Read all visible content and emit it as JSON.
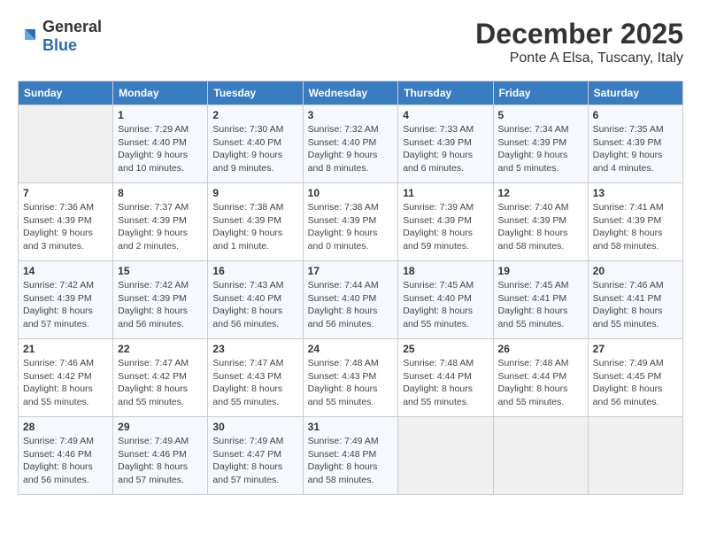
{
  "logo": {
    "general": "General",
    "blue": "Blue"
  },
  "header": {
    "month": "December 2025",
    "location": "Ponte A Elsa, Tuscany, Italy"
  },
  "weekdays": [
    "Sunday",
    "Monday",
    "Tuesday",
    "Wednesday",
    "Thursday",
    "Friday",
    "Saturday"
  ],
  "weeks": [
    [
      {
        "day": "",
        "info": ""
      },
      {
        "day": "1",
        "info": "Sunrise: 7:29 AM\nSunset: 4:40 PM\nDaylight: 9 hours\nand 10 minutes."
      },
      {
        "day": "2",
        "info": "Sunrise: 7:30 AM\nSunset: 4:40 PM\nDaylight: 9 hours\nand 9 minutes."
      },
      {
        "day": "3",
        "info": "Sunrise: 7:32 AM\nSunset: 4:40 PM\nDaylight: 9 hours\nand 8 minutes."
      },
      {
        "day": "4",
        "info": "Sunrise: 7:33 AM\nSunset: 4:39 PM\nDaylight: 9 hours\nand 6 minutes."
      },
      {
        "day": "5",
        "info": "Sunrise: 7:34 AM\nSunset: 4:39 PM\nDaylight: 9 hours\nand 5 minutes."
      },
      {
        "day": "6",
        "info": "Sunrise: 7:35 AM\nSunset: 4:39 PM\nDaylight: 9 hours\nand 4 minutes."
      }
    ],
    [
      {
        "day": "7",
        "info": "Sunrise: 7:36 AM\nSunset: 4:39 PM\nDaylight: 9 hours\nand 3 minutes."
      },
      {
        "day": "8",
        "info": "Sunrise: 7:37 AM\nSunset: 4:39 PM\nDaylight: 9 hours\nand 2 minutes."
      },
      {
        "day": "9",
        "info": "Sunrise: 7:38 AM\nSunset: 4:39 PM\nDaylight: 9 hours\nand 1 minute."
      },
      {
        "day": "10",
        "info": "Sunrise: 7:38 AM\nSunset: 4:39 PM\nDaylight: 9 hours\nand 0 minutes."
      },
      {
        "day": "11",
        "info": "Sunrise: 7:39 AM\nSunset: 4:39 PM\nDaylight: 8 hours\nand 59 minutes."
      },
      {
        "day": "12",
        "info": "Sunrise: 7:40 AM\nSunset: 4:39 PM\nDaylight: 8 hours\nand 58 minutes."
      },
      {
        "day": "13",
        "info": "Sunrise: 7:41 AM\nSunset: 4:39 PM\nDaylight: 8 hours\nand 58 minutes."
      }
    ],
    [
      {
        "day": "14",
        "info": "Sunrise: 7:42 AM\nSunset: 4:39 PM\nDaylight: 8 hours\nand 57 minutes."
      },
      {
        "day": "15",
        "info": "Sunrise: 7:42 AM\nSunset: 4:39 PM\nDaylight: 8 hours\nand 56 minutes."
      },
      {
        "day": "16",
        "info": "Sunrise: 7:43 AM\nSunset: 4:40 PM\nDaylight: 8 hours\nand 56 minutes."
      },
      {
        "day": "17",
        "info": "Sunrise: 7:44 AM\nSunset: 4:40 PM\nDaylight: 8 hours\nand 56 minutes."
      },
      {
        "day": "18",
        "info": "Sunrise: 7:45 AM\nSunset: 4:40 PM\nDaylight: 8 hours\nand 55 minutes."
      },
      {
        "day": "19",
        "info": "Sunrise: 7:45 AM\nSunset: 4:41 PM\nDaylight: 8 hours\nand 55 minutes."
      },
      {
        "day": "20",
        "info": "Sunrise: 7:46 AM\nSunset: 4:41 PM\nDaylight: 8 hours\nand 55 minutes."
      }
    ],
    [
      {
        "day": "21",
        "info": "Sunrise: 7:46 AM\nSunset: 4:42 PM\nDaylight: 8 hours\nand 55 minutes."
      },
      {
        "day": "22",
        "info": "Sunrise: 7:47 AM\nSunset: 4:42 PM\nDaylight: 8 hours\nand 55 minutes."
      },
      {
        "day": "23",
        "info": "Sunrise: 7:47 AM\nSunset: 4:43 PM\nDaylight: 8 hours\nand 55 minutes."
      },
      {
        "day": "24",
        "info": "Sunrise: 7:48 AM\nSunset: 4:43 PM\nDaylight: 8 hours\nand 55 minutes."
      },
      {
        "day": "25",
        "info": "Sunrise: 7:48 AM\nSunset: 4:44 PM\nDaylight: 8 hours\nand 55 minutes."
      },
      {
        "day": "26",
        "info": "Sunrise: 7:48 AM\nSunset: 4:44 PM\nDaylight: 8 hours\nand 55 minutes."
      },
      {
        "day": "27",
        "info": "Sunrise: 7:49 AM\nSunset: 4:45 PM\nDaylight: 8 hours\nand 56 minutes."
      }
    ],
    [
      {
        "day": "28",
        "info": "Sunrise: 7:49 AM\nSunset: 4:46 PM\nDaylight: 8 hours\nand 56 minutes."
      },
      {
        "day": "29",
        "info": "Sunrise: 7:49 AM\nSunset: 4:46 PM\nDaylight: 8 hours\nand 57 minutes."
      },
      {
        "day": "30",
        "info": "Sunrise: 7:49 AM\nSunset: 4:47 PM\nDaylight: 8 hours\nand 57 minutes."
      },
      {
        "day": "31",
        "info": "Sunrise: 7:49 AM\nSunset: 4:48 PM\nDaylight: 8 hours\nand 58 minutes."
      },
      {
        "day": "",
        "info": ""
      },
      {
        "day": "",
        "info": ""
      },
      {
        "day": "",
        "info": ""
      }
    ]
  ]
}
